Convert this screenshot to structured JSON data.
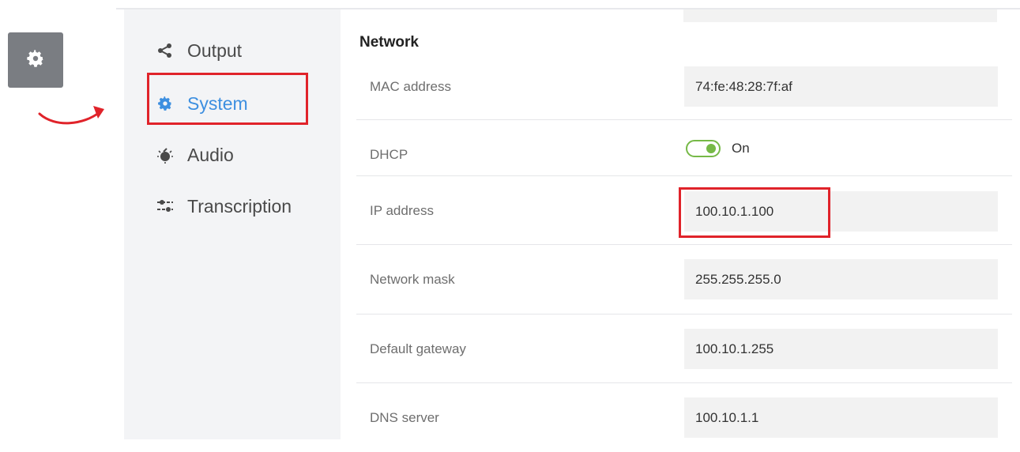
{
  "launcher": {
    "icon": "gear-icon",
    "color": "#7a7d82"
  },
  "annotation": {
    "arrow_icon": "curved-arrow-icon",
    "highlight_color": "#e0232a"
  },
  "sidebar": {
    "items": [
      {
        "label": "Output",
        "icon": "share-icon",
        "active": false
      },
      {
        "label": "System",
        "icon": "gear-icon",
        "active": true
      },
      {
        "label": "Audio",
        "icon": "audio-icon",
        "active": false
      },
      {
        "label": "Transcription",
        "icon": "sliders-icon",
        "active": false
      }
    ],
    "active_color": "#3d8fe0"
  },
  "network": {
    "title": "Network",
    "mac": {
      "label": "MAC address",
      "value": "74:fe:48:28:7f:af"
    },
    "dhcp": {
      "label": "DHCP",
      "state": "On",
      "accent": "#76b947"
    },
    "ip": {
      "label": "IP address",
      "value": "100.10.1.100"
    },
    "mask": {
      "label": "Network mask",
      "value": "255.255.255.0"
    },
    "gateway": {
      "label": "Default gateway",
      "value": "100.10.1.255"
    },
    "dns": {
      "label": "DNS server",
      "value": "100.10.1.1"
    }
  }
}
